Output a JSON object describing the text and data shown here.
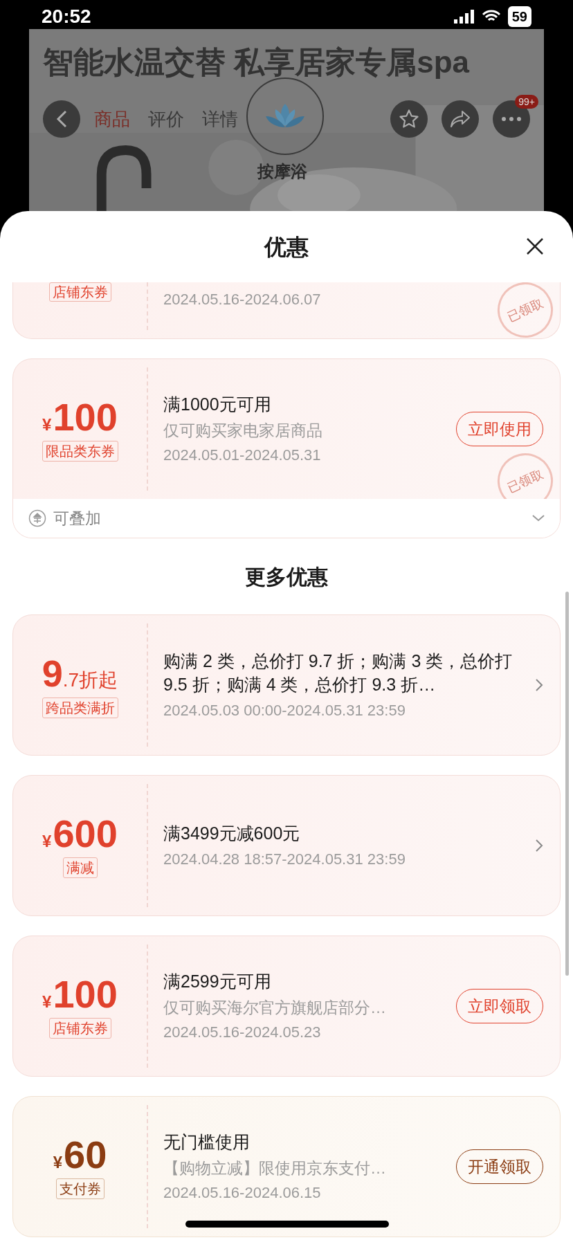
{
  "status_bar": {
    "time": "20:52",
    "battery": "59"
  },
  "background": {
    "headline": "智能水温交替 私享居家专属spa",
    "tabs": [
      {
        "label": "商品",
        "selected": true
      },
      {
        "label": "评价",
        "selected": false
      },
      {
        "label": "详情",
        "selected": false
      }
    ],
    "category": "按摩浴",
    "badge": "99+"
  },
  "sheet": {
    "title": "优惠"
  },
  "coupons": [
    {
      "kind": "partial",
      "tag": "店铺东券",
      "date": "2024.05.16-2024.06.07",
      "claimed": true,
      "stamp": "已领取"
    },
    {
      "kind": "coupon",
      "currency": "¥",
      "amount": "100",
      "tag": "限品类东券",
      "title": "满1000元可用",
      "desc": "仅可购买家电家居商品",
      "date": "2024.05.01-2024.05.31",
      "button": "立即使用",
      "claimed": true,
      "stamp": "已领取",
      "footer": "可叠加"
    }
  ],
  "more_title": "更多优惠",
  "more_coupons": [
    {
      "kind": "discount",
      "color": "#e0412c",
      "amount": "9",
      "suffix": ".7折起",
      "tag": "跨品类满折",
      "title": "购满 2 类，总价打 9.7 折；购满 3 类，总价打 9.5 折；购满 4 类，总价打 9.3 折…",
      "date": "2024.05.03 00:00-2024.05.31 23:59",
      "arrow": true
    },
    {
      "kind": "coupon",
      "color": "#e0412c",
      "currency": "¥",
      "amount": "600",
      "tag": "满减",
      "title": "满3499元减600元",
      "date": "2024.04.28 18:57-2024.05.31 23:59",
      "arrow": true
    },
    {
      "kind": "coupon",
      "color": "#e0412c",
      "currency": "¥",
      "amount": "100",
      "tag": "店铺东券",
      "title": "满2599元可用",
      "desc": "仅可购买海尔官方旗舰店部分…",
      "date": "2024.05.16-2024.05.23",
      "button": "立即领取"
    },
    {
      "kind": "coupon",
      "color": "#8b3c12",
      "currency": "¥",
      "amount": "60",
      "tag": "支付券",
      "title": "无门槛使用",
      "desc": "【购物立减】限使用京东支付…",
      "date": "2024.05.16-2024.06.15",
      "button": "开通领取"
    }
  ]
}
